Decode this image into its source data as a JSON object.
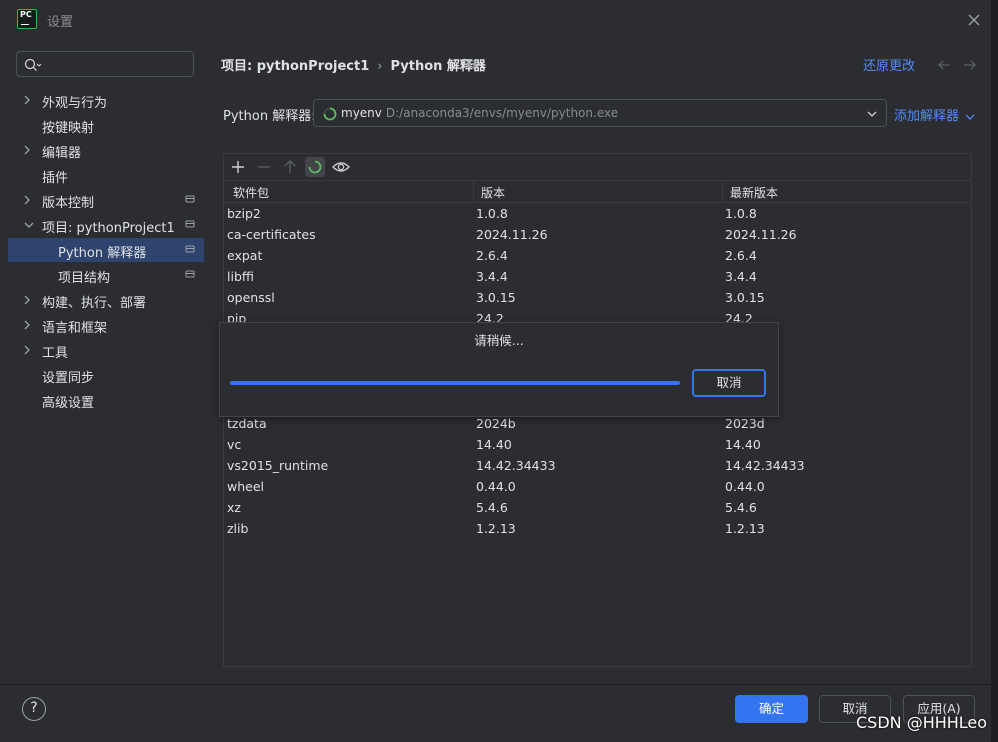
{
  "window": {
    "title": "设置"
  },
  "search": {
    "placeholder": ""
  },
  "sidebar": {
    "items": [
      {
        "label": "外观与行为"
      },
      {
        "label": "按键映射"
      },
      {
        "label": "编辑器"
      },
      {
        "label": "插件"
      },
      {
        "label": "版本控制"
      },
      {
        "label": "项目: pythonProject1"
      },
      {
        "label": "Python 解释器"
      },
      {
        "label": "项目结构"
      },
      {
        "label": "构建、执行、部署"
      },
      {
        "label": "语言和框架"
      },
      {
        "label": "工具"
      },
      {
        "label": "设置同步"
      },
      {
        "label": "高级设置"
      }
    ]
  },
  "header": {
    "crumb_project": "项目: pythonProject1",
    "separator": "›",
    "crumb_page": "Python 解释器",
    "revert_label": "还原更改"
  },
  "interpreter": {
    "label": "Python 解释器:",
    "name": "myenv",
    "path": "D:/anaconda3/envs/myenv/python.exe",
    "add_label": "添加解释器"
  },
  "table": {
    "columns": [
      "软件包",
      "版本",
      "最新版本"
    ],
    "rows": [
      [
        "bzip2",
        "1.0.8",
        "1.0.8"
      ],
      [
        "ca-certificates",
        "2024.11.26",
        "2024.11.26"
      ],
      [
        "expat",
        "2.6.4",
        "2.6.4"
      ],
      [
        "libffi",
        "3.4.4",
        "3.4.4"
      ],
      [
        "openssl",
        "3.0.15",
        "3.0.15"
      ],
      [
        "pip",
        "24.2",
        "24.2"
      ],
      [
        "tzdata",
        "2024b",
        "2023d"
      ],
      [
        "vc",
        "14.40",
        "14.40"
      ],
      [
        "vs2015_runtime",
        "14.42.34433",
        "14.42.34433"
      ],
      [
        "wheel",
        "0.44.0",
        "0.44.0"
      ],
      [
        "xz",
        "5.4.6",
        "5.4.6"
      ],
      [
        "zlib",
        "1.2.13",
        "1.2.13"
      ]
    ]
  },
  "progress_dialog": {
    "message": "请稍候...",
    "cancel_label": "取消",
    "progress": 1.0
  },
  "footer": {
    "help_label": "?",
    "ok_label": "确定",
    "cancel_label": "取消",
    "apply_label": "应用(A)"
  },
  "watermark": "CSDN @HHHLeo",
  "colors": {
    "accent": "#3574f0",
    "link": "#548af7",
    "selection": "#2e436e",
    "background": "#2b2d30"
  }
}
